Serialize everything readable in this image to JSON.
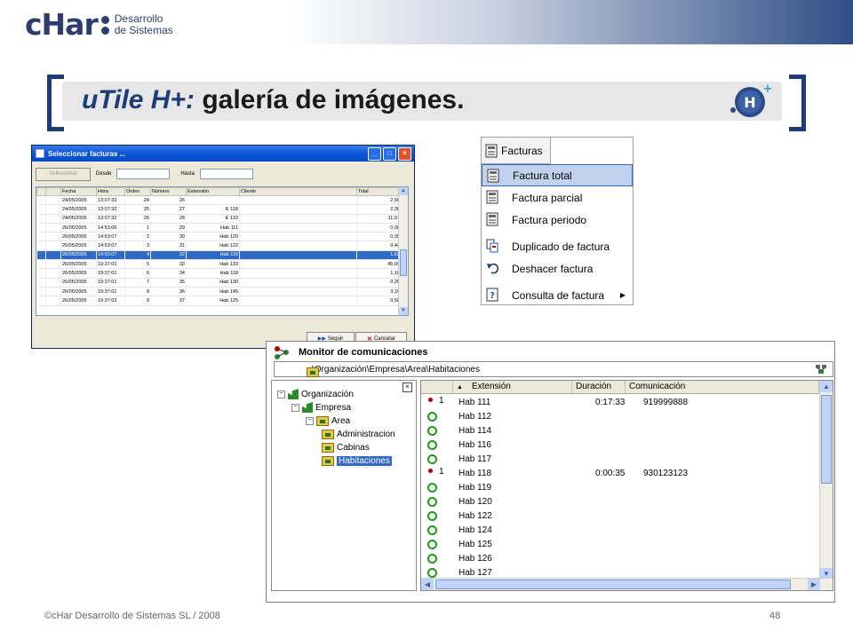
{
  "header": {
    "brand": "cHar",
    "brand_sub_1": "Desarrollo",
    "brand_sub_2": "de Sistemas",
    "title_prefix": "uTile H+:",
    "title_rest": " galería de imágenes."
  },
  "footer": {
    "copyright": "©cHar Desarrollo de Sistemas SL / 2008",
    "page": "48"
  },
  "facturas_window": {
    "title": "Seleccionar facturas ...",
    "select_button": "Seleccionar",
    "desde_label": "Desde",
    "hasta_label": "Hasta",
    "columns": [
      "Fecha",
      "Hora",
      "Orden",
      "Número",
      "Extensión",
      "Cliente",
      "Total"
    ],
    "rows": [
      {
        "mark": "",
        "fecha": "24/05/2005",
        "hora": "13:07:32",
        "orden": "24",
        "numero": "26",
        "ext": "",
        "cliente": "",
        "total": "2,56"
      },
      {
        "mark": "",
        "fecha": "24/05/2005",
        "hora": "13:07:32",
        "orden": "25",
        "numero": "27",
        "ext": "E 118",
        "cliente": "",
        "total": "2,30"
      },
      {
        "mark": "",
        "fecha": "24/05/2005",
        "hora": "13:07:32",
        "orden": "26",
        "numero": "28",
        "ext": "E 133",
        "cliente": "",
        "total": "11,97"
      },
      {
        "mark": "",
        "fecha": "26/05/2005",
        "hora": "14:53:06",
        "orden": "1",
        "numero": "29",
        "ext": "Hab 111",
        "cliente": "",
        "total": "0,08"
      },
      {
        "mark": "",
        "fecha": "26/05/2005",
        "hora": "14:53:07",
        "orden": "2",
        "numero": "30",
        "ext": "Hab 120",
        "cliente": "",
        "total": "0,35"
      },
      {
        "mark": "",
        "fecha": "26/05/2005",
        "hora": "14:53:07",
        "orden": "3",
        "numero": "31",
        "ext": "Hab 122",
        "cliente": "",
        "total": "0,44"
      },
      {
        "mark": "•",
        "fecha": "26/05/2005",
        "hora": "14:53:07",
        "orden": "4",
        "numero": "32",
        "ext": "Hab 116",
        "cliente": "",
        "total": "1,62"
      },
      {
        "mark": "",
        "fecha": "26/05/2005",
        "hora": "19:37:01",
        "orden": "5",
        "numero": "33",
        "ext": "Hab 133",
        "cliente": "",
        "total": "45,09"
      },
      {
        "mark": "",
        "fecha": "26/05/2005",
        "hora": "19:37:01",
        "orden": "6",
        "numero": "34",
        "ext": "Hab 118",
        "cliente": "",
        "total": "1,10"
      },
      {
        "mark": "",
        "fecha": "26/05/2005",
        "hora": "19:37:01",
        "orden": "7",
        "numero": "35",
        "ext": "Hab 130",
        "cliente": "",
        "total": "0,26"
      },
      {
        "mark": "",
        "fecha": "26/05/2005",
        "hora": "19:37:01",
        "orden": "8",
        "numero": "36",
        "ext": "Hab 145",
        "cliente": "",
        "total": "3,16"
      },
      {
        "mark": "",
        "fecha": "26/05/2005",
        "hora": "19:37:02",
        "orden": "9",
        "numero": "37",
        "ext": "Hab 125",
        "cliente": "",
        "total": "0,58"
      }
    ],
    "selected_row": 6,
    "seguir_label": "Seguir",
    "cancelar_label": "Cancelar"
  },
  "menu": {
    "tab_label": "Facturas",
    "items": [
      {
        "label": "Factura total",
        "icon": "document-icon"
      },
      {
        "label": "Factura parcial",
        "icon": "document-icon"
      },
      {
        "label": "Factura periodo",
        "icon": "document-icon"
      },
      {
        "label": "Duplicado de factura",
        "icon": "duplicate-icon"
      },
      {
        "label": "Deshacer factura",
        "icon": "undo-icon"
      },
      {
        "label": "Consulta de factura",
        "icon": "help-document-icon"
      }
    ],
    "highlighted_index": 0
  },
  "monitor": {
    "title": "Monitor de comunicaciones",
    "path": "\\Organización\\Empresa\\Area\\Habitaciones",
    "tree": [
      {
        "label": "Organización",
        "level": 0
      },
      {
        "label": "Empresa",
        "level": 1
      },
      {
        "label": "Area",
        "level": 2
      },
      {
        "label": "Administracion",
        "level": 3
      },
      {
        "label": "Cabinas",
        "level": 3
      },
      {
        "label": "Habitaciones",
        "level": 3
      }
    ],
    "selected_tree_index": 5,
    "columns": [
      "Extensión",
      "Duración",
      "Comunicación"
    ],
    "rows": [
      {
        "status": "active",
        "count": "1",
        "ext": "Hab 111",
        "dur": "0:17:33",
        "com": "919999888"
      },
      {
        "status": "idle",
        "count": "",
        "ext": "Hab 112",
        "dur": "",
        "com": ""
      },
      {
        "status": "idle",
        "count": "",
        "ext": "Hab 114",
        "dur": "",
        "com": ""
      },
      {
        "status": "idle",
        "count": "",
        "ext": "Hab 116",
        "dur": "",
        "com": ""
      },
      {
        "status": "idle",
        "count": "",
        "ext": "Hab 117",
        "dur": "",
        "com": ""
      },
      {
        "status": "active",
        "count": "1",
        "ext": "Hab 118",
        "dur": "0:00:35",
        "com": "930123123"
      },
      {
        "status": "idle",
        "count": "",
        "ext": "Hab 119",
        "dur": "",
        "com": ""
      },
      {
        "status": "idle",
        "count": "",
        "ext": "Hab 120",
        "dur": "",
        "com": ""
      },
      {
        "status": "idle",
        "count": "",
        "ext": "Hab 122",
        "dur": "",
        "com": ""
      },
      {
        "status": "idle",
        "count": "",
        "ext": "Hab 124",
        "dur": "",
        "com": ""
      },
      {
        "status": "idle",
        "count": "",
        "ext": "Hab 125",
        "dur": "",
        "com": ""
      },
      {
        "status": "idle",
        "count": "",
        "ext": "Hab 126",
        "dur": "",
        "com": ""
      },
      {
        "status": "idle",
        "count": "",
        "ext": "Hab 127",
        "dur": "",
        "com": ""
      }
    ]
  },
  "colors": {
    "accent": "#1c3d7a",
    "selection": "#316ac5",
    "xp_title": "#0a56d8",
    "status_idle": "#1f9a1f",
    "status_active": "#b00000"
  }
}
